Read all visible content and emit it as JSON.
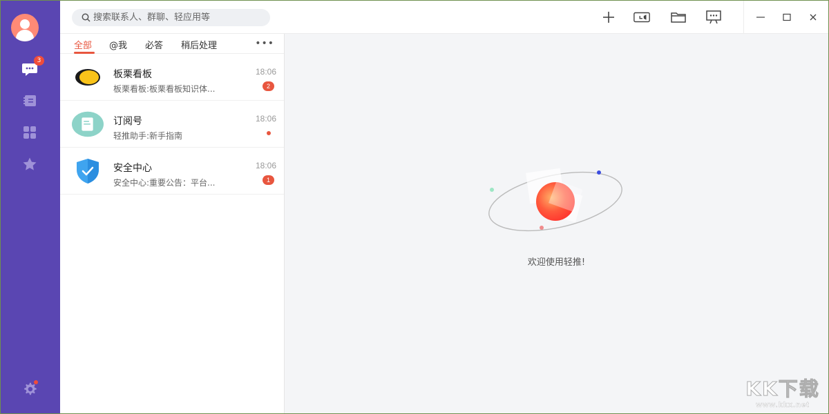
{
  "sidebar": {
    "chat_badge": "3",
    "items": [
      {
        "icon": "chat-icon"
      },
      {
        "icon": "contacts-book-icon"
      },
      {
        "icon": "apps-grid-icon"
      },
      {
        "icon": "star-icon"
      }
    ],
    "settings_icon": "gear-icon",
    "accent": "#5a46b2"
  },
  "header": {
    "search_placeholder": "搜索联系人、群聊、轻应用等",
    "tools": [
      "plus-icon",
      "video-call-icon",
      "folder-icon",
      "presentation-icon"
    ],
    "window_controls": [
      "minimize-icon",
      "maximize-icon",
      "close-icon"
    ]
  },
  "tabs": [
    {
      "label": "全部",
      "active": true
    },
    {
      "label": "@我",
      "active": false
    },
    {
      "label": "必答",
      "active": false
    },
    {
      "label": "稍后处理",
      "active": false
    }
  ],
  "conversations": [
    {
      "title": "板栗看板",
      "preview": "板栗看板:板栗看板知识体...",
      "time": "18:06",
      "badge": "2",
      "icon": "banli-kanban-logo"
    },
    {
      "title": "订阅号",
      "preview": "轻推助手:新手指南",
      "time": "18:06",
      "dot": true,
      "icon": "subscription-icon"
    },
    {
      "title": "安全中心",
      "preview": "安全中心:重要公告：平台...",
      "time": "18:06",
      "badge": "1",
      "icon": "shield-check-icon"
    }
  ],
  "main": {
    "welcome": "欢迎使用轻推!"
  },
  "watermark": {
    "main": "KK下载",
    "sub": "www.kkx.net"
  },
  "colors": {
    "accent_red": "#e8563f",
    "rail": "#5a46b2"
  }
}
